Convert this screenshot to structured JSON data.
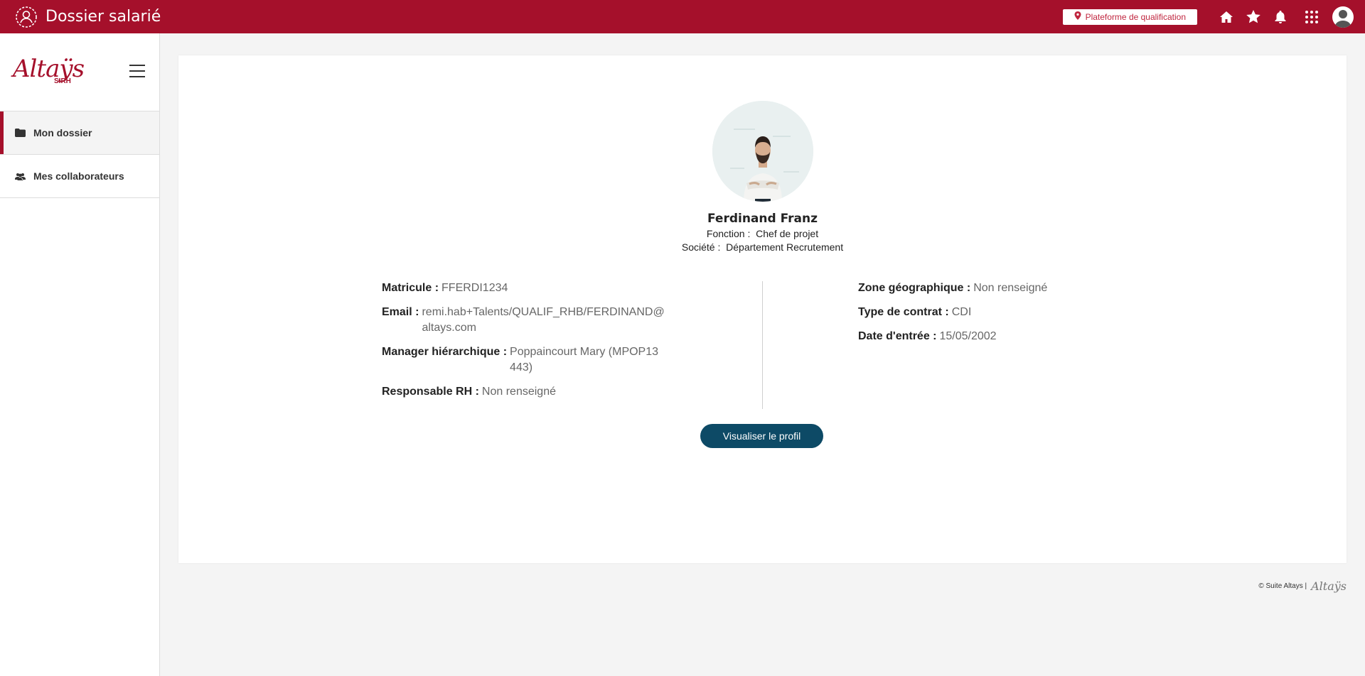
{
  "header": {
    "title": "Dossier salarié",
    "platform": "Plateforme de qualification"
  },
  "sidebar": {
    "logo": "Altaÿs",
    "logo_sub": "SIRH",
    "items": [
      {
        "label": "Mon dossier",
        "icon": "folder-icon"
      },
      {
        "label": "Mes collaborateurs",
        "icon": "users-icon"
      }
    ]
  },
  "profile": {
    "name": "Ferdinand Franz",
    "function_label": "Fonction :",
    "function_value": "Chef de projet",
    "company_label": "Société :",
    "company_value": "Département Recrutement"
  },
  "fields_left": [
    {
      "label": "Matricule :",
      "value": "FFERDI1234"
    },
    {
      "label": "Email :",
      "value": "remi.hab+Talents/QUALIF_RHB/FERDINAND@altays.com"
    },
    {
      "label": "Manager hiérarchique :",
      "value": "Poppaincourt Mary (MPOP13443)"
    },
    {
      "label": "Responsable RH :",
      "value": "Non renseigné"
    }
  ],
  "fields_right": [
    {
      "label": "Zone géographique :",
      "value": "Non renseigné"
    },
    {
      "label": "Type de contrat :",
      "value": "CDI"
    },
    {
      "label": "Date d'entrée :",
      "value": "15/05/2002"
    }
  ],
  "actions": {
    "view_profile": "Visualiser le profil"
  },
  "footer": {
    "text": "© Suite Altays |",
    "logo": "Altaÿs"
  },
  "colors": {
    "brand": "#a5102b",
    "button": "#0d4a66"
  }
}
